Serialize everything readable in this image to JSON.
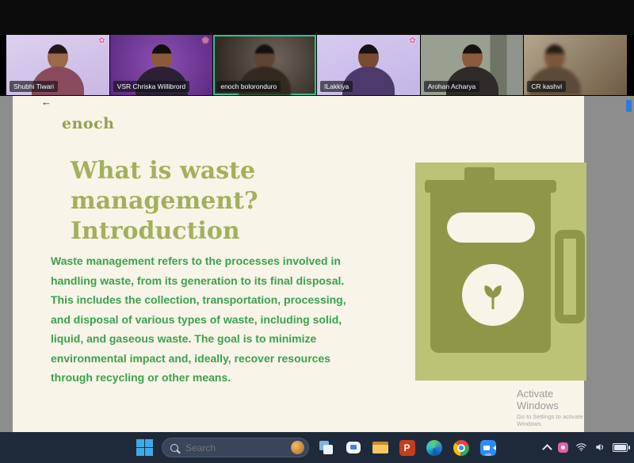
{
  "meeting": {
    "participants": [
      {
        "name": "Shubhi Tiwari"
      },
      {
        "name": "VSR Chriska Willibrord"
      },
      {
        "name": "enoch boloronduro"
      },
      {
        "name": "ILakkiya"
      },
      {
        "name": "Arohan Acharya"
      },
      {
        "name": "CR kashvi"
      }
    ],
    "active_speaker": "enoch boloronduro",
    "active_border_color": "#35c08e"
  },
  "slide": {
    "presenter": "enoch",
    "title_lines": [
      "What is waste",
      "management?",
      "Introduction"
    ],
    "body_lines": [
      "Waste management refers to the processes involved in",
      "handling waste, from its generation to its final disposal.",
      "This includes the collection, transportation, processing,",
      "and disposal of various types of waste, including solid,",
      "liquid, and gaseous waste. The goal is to minimize",
      "environmental impact and, ideally, recover resources",
      "through recycling or other means."
    ],
    "colors": {
      "slide_bg": "#f8f4e8",
      "title": "#a3b05c",
      "body": "#3aa24e",
      "panel": "#bcc276",
      "can": "#8e9747"
    }
  },
  "watermark": {
    "title": "Activate Windows",
    "subtitle": "Go to Settings to activate Windows."
  },
  "taskbar": {
    "search_placeholder": "Search",
    "powerpoint_letter": "P",
    "icons": [
      "start",
      "task-view",
      "chat",
      "file-explorer",
      "powerpoint",
      "edge",
      "chrome",
      "zoom",
      "tray-chevron",
      "tray-app",
      "wifi",
      "volume",
      "battery"
    ]
  }
}
